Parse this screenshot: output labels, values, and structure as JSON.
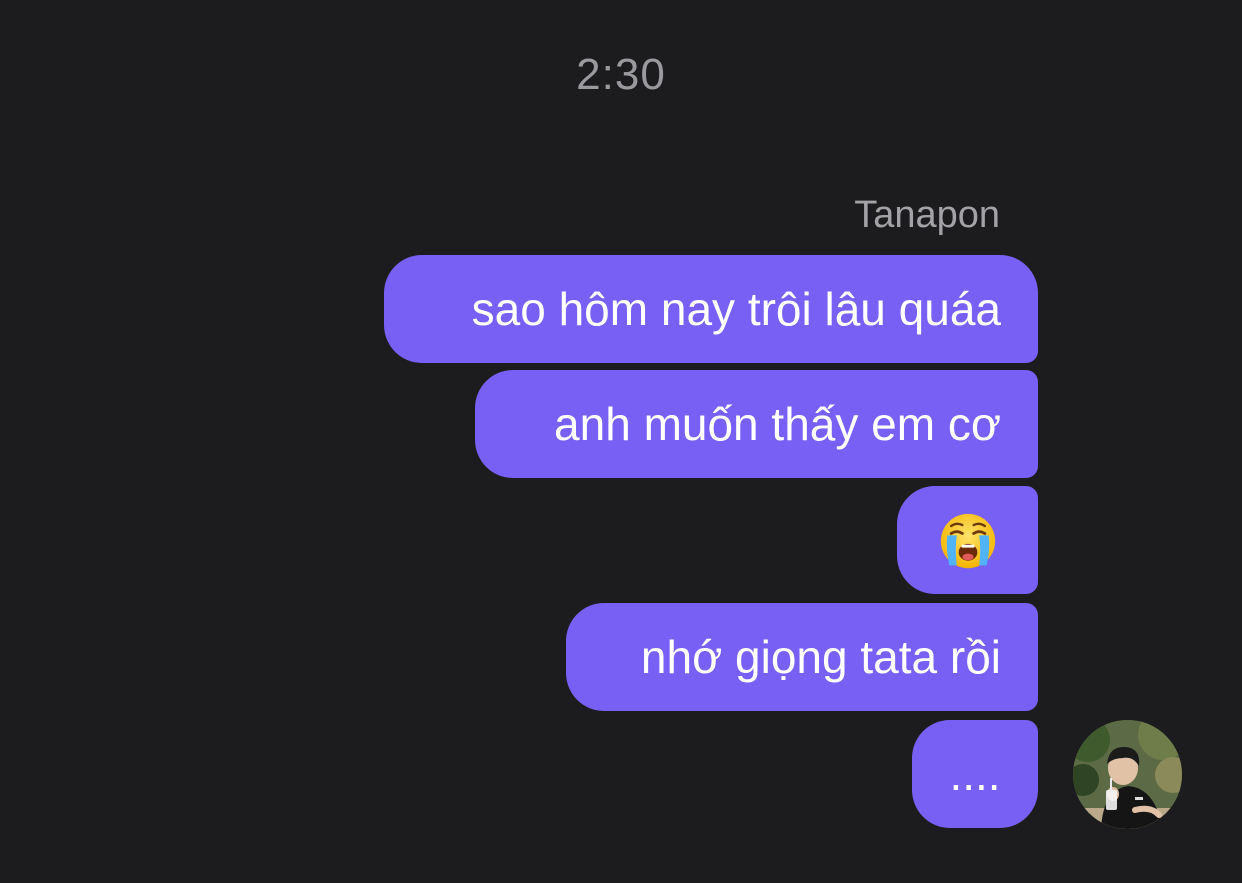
{
  "chat": {
    "timestamp": "2:30",
    "sender_name": "Tanapon",
    "messages": [
      {
        "text": "sao hôm nay trôi lâu quáa"
      },
      {
        "text": "anh muốn thấy em cơ"
      },
      {
        "text": "",
        "emoji": "loudly-crying-face-icon"
      },
      {
        "text": "nhớ giọng tata rồi"
      },
      {
        "text": "...."
      }
    ],
    "avatar": "profile-photo-avatar"
  },
  "colors": {
    "background": "#1c1c1e",
    "bubble": "#7760f3",
    "bubble_text": "#ffffff",
    "meta_text": "#9a9a9e"
  }
}
